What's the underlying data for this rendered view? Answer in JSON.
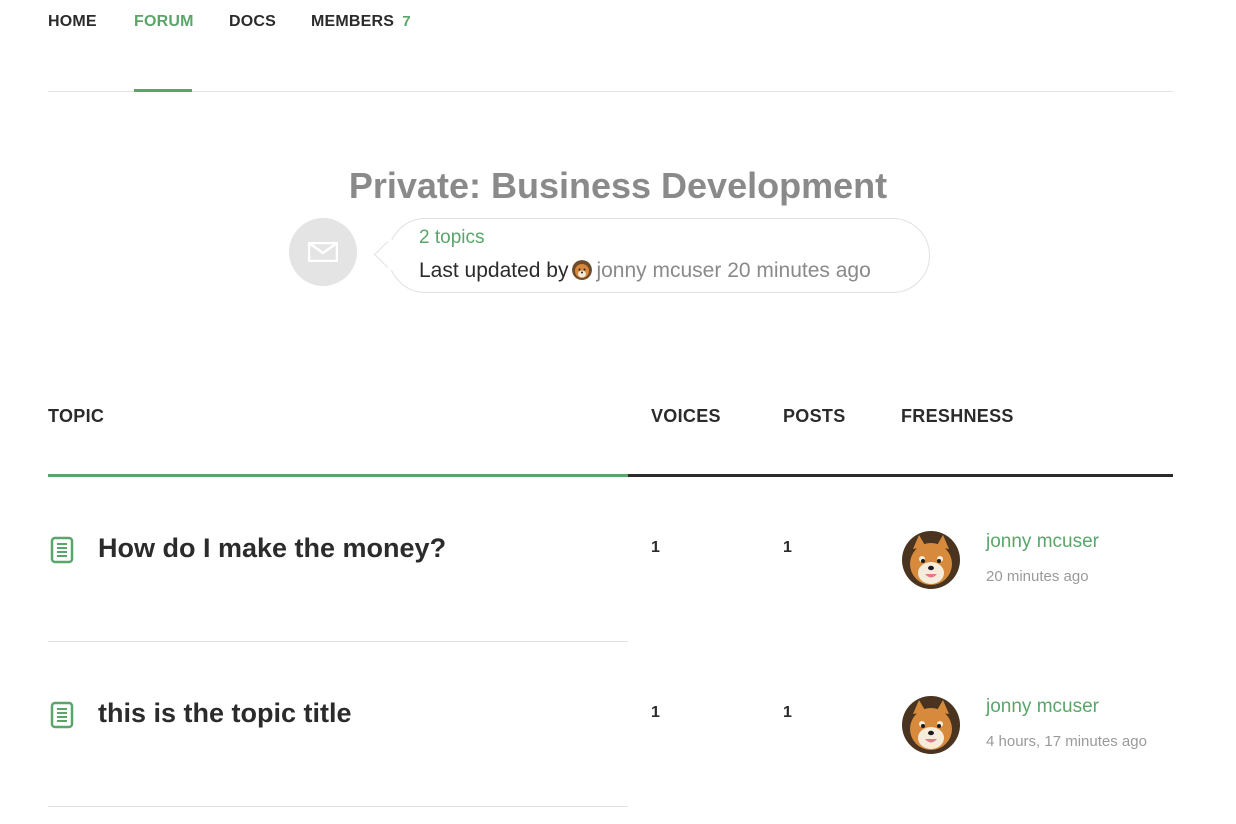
{
  "nav": {
    "home": "HOME",
    "forum": "FORUM",
    "docs": "DOCS",
    "members": "MEMBERS",
    "members_count": "7"
  },
  "forum": {
    "title": "Private: Business Development",
    "topic_count": "2 topics",
    "last_updated_prefix": "Last updated by",
    "last_updated_user": "jonny mcuser",
    "last_updated_time": "20 minutes ago",
    "avatar_icon": "envelope-icon"
  },
  "table": {
    "headers": {
      "topic": "TOPIC",
      "voices": "VOICES",
      "posts": "POSTS",
      "freshness": "FRESHNESS"
    },
    "rows": [
      {
        "title": "How do I make the money?",
        "voices": "1",
        "posts": "1",
        "user": "jonny mcuser",
        "time": "20 minutes ago",
        "icon": "document-icon"
      },
      {
        "title": "this is the topic title",
        "voices": "1",
        "posts": "1",
        "user": "jonny mcuser",
        "time": "4 hours, 17 minutes ago",
        "icon": "document-icon"
      }
    ]
  },
  "colors": {
    "accent": "#5aa66a",
    "text": "#2b2b2b",
    "muted": "#8a8a8a"
  }
}
